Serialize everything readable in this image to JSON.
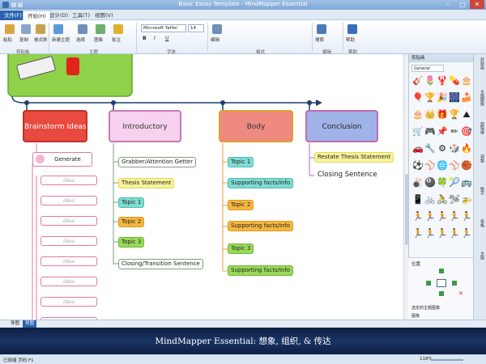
{
  "window": {
    "title": "Basic Essay Template - MindMapper Essential",
    "min": "–",
    "max": "□",
    "close": "✕"
  },
  "tabs": [
    "文件(F)",
    "开始(H)",
    "设计(D)",
    "工具(T)",
    "视图(V)"
  ],
  "ribbon": {
    "buttons": [
      {
        "label": "粘贴",
        "icon": "paste-icon",
        "color": "#d9a441"
      },
      {
        "label": "复制",
        "icon": "copy-icon",
        "color": "#8aa6c8"
      },
      {
        "label": "格式刷",
        "icon": "format-painter-icon",
        "color": "#c8a050"
      },
      {
        "label": "新建主题",
        "icon": "new-topic-icon",
        "color": "#5a9ad8"
      },
      {
        "label": "选择",
        "icon": "select-icon",
        "color": "#6f8fb8"
      },
      {
        "label": "图像",
        "icon": "image-icon",
        "color": "#6bb06b"
      },
      {
        "label": "批注",
        "icon": "comment-icon",
        "color": "#e0b030"
      },
      {
        "label": "编辑",
        "icon": "edit-icon",
        "color": "#6f8fb8"
      },
      {
        "label": "搜索",
        "icon": "search-icon",
        "color": "#4a7ab8"
      },
      {
        "label": "帮助",
        "icon": "help-icon",
        "color": "#3a6fc0"
      }
    ],
    "groups": [
      "剪贴板",
      "主题",
      "字体",
      "格式",
      "编辑",
      "帮助"
    ],
    "font": "Microsoft YaHei",
    "size": "14"
  },
  "left_sidebar": "属性",
  "map": {
    "main_topics": [
      {
        "label": "Brainstorm Ideas",
        "fill": "#e94a3f",
        "border": "#c0302a",
        "text": "#ffffff"
      },
      {
        "label": "Introductory",
        "fill": "#f7d2ee",
        "border": "#c87ab4",
        "text": "#333333"
      },
      {
        "label": "Body",
        "fill": "#ef8a80",
        "border": "#e0a030",
        "text": "#333333"
      },
      {
        "label": "Conclusion",
        "fill": "#9fb3e8",
        "border": "#c06ab0",
        "text": "#222222"
      }
    ],
    "generate": "Generate",
    "idea": "Idea",
    "intro_subs": [
      {
        "label": "Grabber/Attention Getter",
        "bg": "#ffffff",
        "bd": "#7aa27a"
      },
      {
        "label": "Thesis Statement",
        "bg": "#f7f29a",
        "bd": "#e0d860"
      },
      {
        "label": "Topic 1",
        "bg": "#7fdcd2",
        "bd": "#4cbcb0"
      },
      {
        "label": "Topic 2",
        "bg": "#f5b640",
        "bd": "#d89a20"
      },
      {
        "label": "Topic 3",
        "bg": "#99d95a",
        "bd": "#6cb838"
      },
      {
        "label": "Closing/Transition Sentence",
        "bg": "#ffffff",
        "bd": "#7aa27a"
      }
    ],
    "body_subs": [
      {
        "label": "Topic 1",
        "bg": "#7fdcd2",
        "bd": "#4cbcb0"
      },
      {
        "label": "Supporting facts/info",
        "bg": "#7fdcd2",
        "bd": "#4cbcb0"
      },
      {
        "label": "Topic 2",
        "bg": "#f5b640",
        "bd": "#d89a20"
      },
      {
        "label": "Supporting facts/info",
        "bg": "#f5b640",
        "bd": "#d89a20"
      },
      {
        "label": "Topic 3",
        "bg": "#99d95a",
        "bd": "#6cb838"
      },
      {
        "label": "Supporting facts/info",
        "bg": "#99d95a",
        "bd": "#6cb838"
      }
    ],
    "concl_subs": [
      {
        "label": "Restate Thesis Statement",
        "bg": "#f7f29a",
        "bd": "#e0d860"
      },
      {
        "label": "Closing Sentence",
        "bg": "#ffffff",
        "bd": "#ffffff"
      }
    ]
  },
  "right_panel": {
    "title": "剪贴画",
    "category": "General",
    "position_title": "位置",
    "selected": "选定的主题图像",
    "image_label": "图像"
  },
  "clipart": [
    "🎸",
    "🌷",
    "🦞",
    "💊",
    "🎂",
    "🎈",
    "🏆",
    "🎉",
    "🎆",
    "🍰",
    "🎂",
    "👑",
    "🎁",
    "🏆",
    "⛰",
    "🛒",
    "🎮",
    "📌",
    "✏",
    "🎯",
    "🚗",
    "🔧",
    "⚙",
    "🎲",
    "🔥",
    "⚽",
    "⚾",
    "🌐",
    "⚾",
    "🏀",
    "🎳",
    "🎱",
    "🍀",
    "🎾",
    "🚌",
    "📱",
    "🚲",
    "🚴",
    "🛩",
    "🚁",
    "🏃",
    "🏃",
    "🏃",
    "🏃",
    "🏃",
    "🏃",
    "🏃",
    "🏃",
    "🏃",
    "🏃"
  ],
  "right_tabs": [
    "剪贴画",
    "主题图像",
    "超链接",
    "调整",
    "数字",
    "表格",
    "主题"
  ],
  "bottom_tabs": [
    "导图",
    "导图"
  ],
  "banner": "MindMapper Essential: 想象, 组织, & 传达",
  "status": {
    "left": "已就绪   页码 F1",
    "zoom": "118%"
  }
}
